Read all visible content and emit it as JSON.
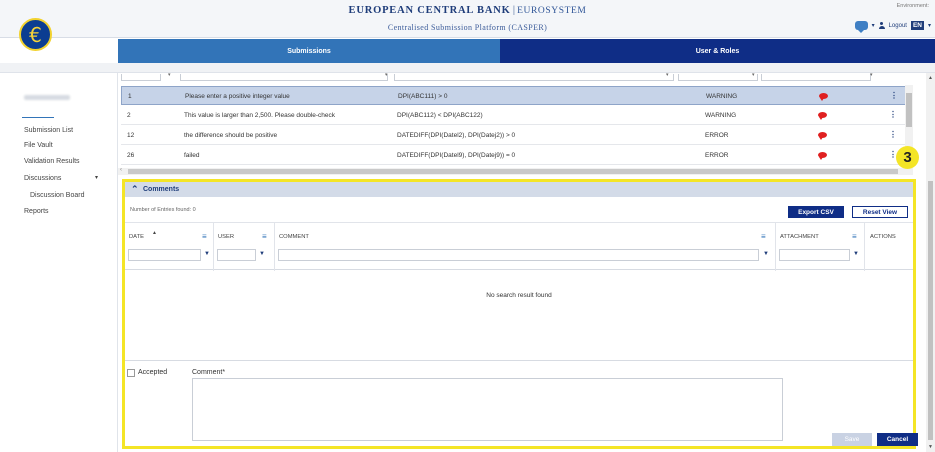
{
  "header": {
    "brand_main": "EUROPEAN CENTRAL BANK",
    "brand_sep": "|",
    "brand_sub": "EUROSYSTEM",
    "platform": "Centralised Submission Platform (CASPER)",
    "environment_label": "Environment:",
    "logout": "Logout",
    "lang": "EN",
    "logo_glyph": "€"
  },
  "nav": {
    "tabs": [
      {
        "label": "Submissions",
        "active": true
      },
      {
        "label": "User & Roles",
        "active": false
      }
    ]
  },
  "sidebar": {
    "items": [
      {
        "label": "Submission List"
      },
      {
        "label": "File Vault"
      },
      {
        "label": "Validation Results"
      },
      {
        "label": "Discussions"
      },
      {
        "label": "Discussion Board"
      },
      {
        "label": "Reports"
      }
    ],
    "caret": "▾"
  },
  "validation_table": {
    "rows": [
      {
        "id": "1",
        "message": "Please enter a positive integer value",
        "expression": "DPI(ABC111) > 0",
        "severity": "WARNING",
        "selected": true
      },
      {
        "id": "2",
        "message": "This value is larger than 2,500. Please double-check",
        "expression": "DPI(ABC112) < DPI(ABC122)",
        "severity": "WARNING",
        "selected": false
      },
      {
        "id": "12",
        "message": "the difference should be positive",
        "expression": "DATEDIFF(DPI(Datel2), DPI(Datej2)) > 0",
        "severity": "ERROR",
        "selected": false
      },
      {
        "id": "26",
        "message": "failed",
        "expression": "DATEDIFF(DPI(Datel9), DPI(Datej9)) = 0",
        "severity": "ERROR",
        "selected": false
      }
    ],
    "action_glyph": "⋮"
  },
  "comments": {
    "title": "Comments",
    "chevron": "⌃",
    "entries_found": "Number of Entries found: 0",
    "export_csv": "Export CSV",
    "reset_view": "Reset View",
    "columns": {
      "date": "DATE",
      "user": "USER",
      "comment": "COMMENT",
      "attachment": "ATTACHMENT",
      "actions": "ACTIONS"
    },
    "sort_glyph": "▲",
    "menu_glyph": "≡",
    "filter_glyph": "▼",
    "no_result": "No search result found",
    "accepted_label": "Accepted",
    "comment_label": "Comment*",
    "save": "Save",
    "cancel": "Cancel"
  },
  "annotation": {
    "number": "3",
    "color": "#f4e526"
  },
  "colors": {
    "nav_light": "#3274b8",
    "nav_dark": "#0f2d86",
    "selected_row": "#c6d3e8",
    "highlight": "#f4e526",
    "comment_icon": "#e02020"
  }
}
